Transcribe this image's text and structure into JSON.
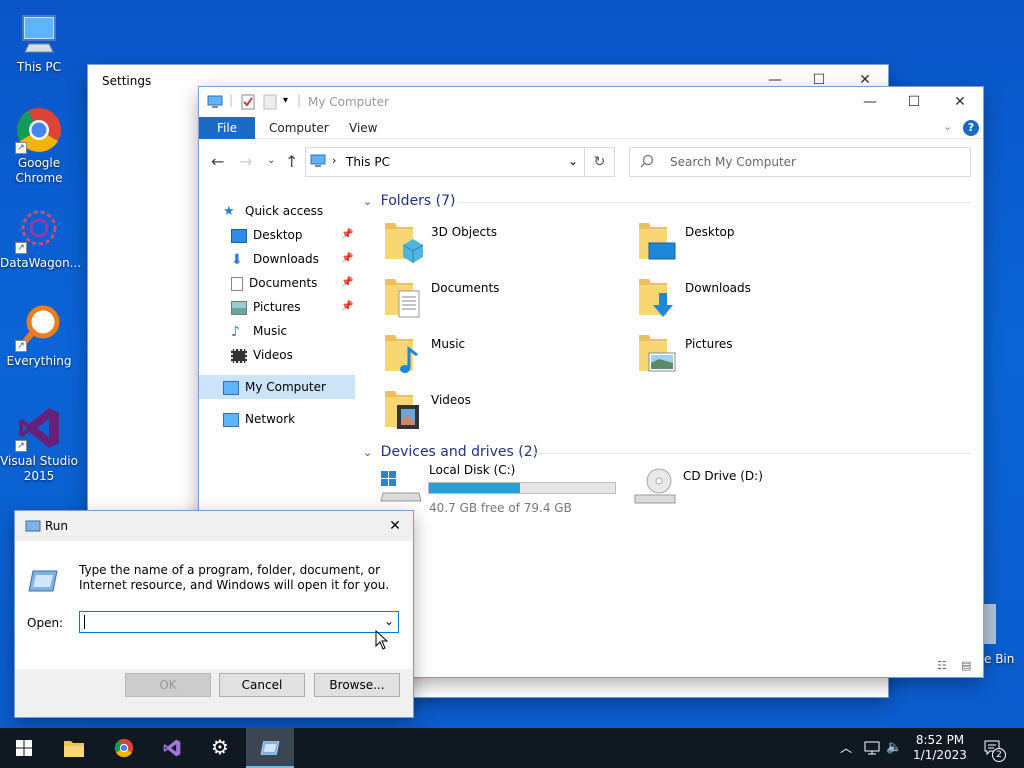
{
  "desktop": {
    "icons": [
      {
        "label": "This PC",
        "icon": "this-pc-icon"
      },
      {
        "label": "Google Chrome",
        "icon": "chrome-icon"
      },
      {
        "label": "DataWagon...",
        "icon": "datawagon-icon"
      },
      {
        "label": "Everything",
        "icon": "everything-icon"
      },
      {
        "label": "Visual Studio 2015",
        "icon": "visual-studio-icon"
      },
      {
        "label": "e Bin",
        "icon": "recycle-bin-icon"
      }
    ]
  },
  "settings": {
    "title": "Settings"
  },
  "explorer": {
    "title": "My Computer",
    "ribbon": {
      "file": "File",
      "computer": "Computer",
      "view": "View"
    },
    "address": {
      "location": "This PC"
    },
    "search": {
      "placeholder": "Search My Computer"
    },
    "nav": {
      "quick_access": "Quick access",
      "items": [
        "Desktop",
        "Downloads",
        "Documents",
        "Pictures",
        "Music",
        "Videos"
      ],
      "my_computer": "My Computer",
      "network": "Network"
    },
    "folders_header": "Folders (7)",
    "folders": [
      "3D Objects",
      "Desktop",
      "Documents",
      "Downloads",
      "Music",
      "Pictures",
      "Videos"
    ],
    "drives_header": "Devices and drives (2)",
    "drives": {
      "c_label": "Local Disk (C:)",
      "c_free": "40.7 GB free of 79.4 GB",
      "c_used_fraction": 0.487,
      "d_label": "CD Drive (D:)"
    }
  },
  "run": {
    "title": "Run",
    "description": "Type the name of a program, folder, document, or Internet resource, and Windows will open it for you.",
    "open_label": "Open:",
    "open_value": "",
    "ok": "OK",
    "cancel": "Cancel",
    "browse": "Browse..."
  },
  "taskbar": {
    "time": "8:52 PM",
    "date": "1/1/2023",
    "notification_count": "2"
  },
  "colors": {
    "accent": "#1a6ac7",
    "taskbar": "#101922",
    "drive_bar": "#26a0da"
  }
}
